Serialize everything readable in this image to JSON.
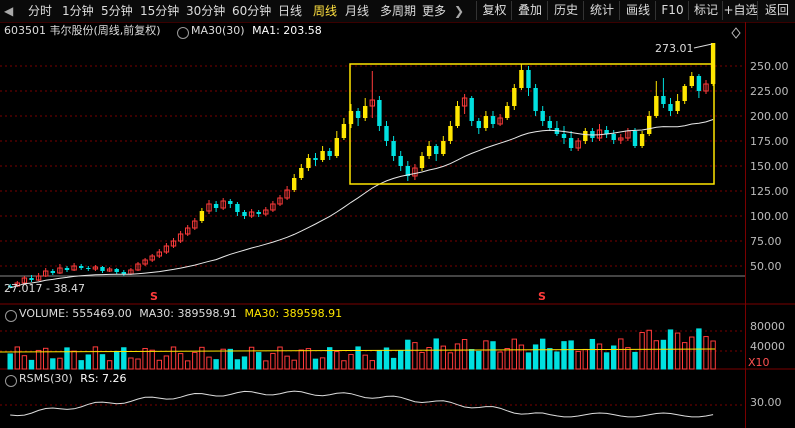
{
  "toolbar": {
    "left_arrow": "◀",
    "periods": [
      "分时",
      "1分钟",
      "5分钟",
      "15分钟",
      "30分钟",
      "60分钟",
      "日线",
      "周线",
      "月线",
      "多周期",
      "更多"
    ],
    "active_period": "周线",
    "more_arrow": "❯",
    "buttons": [
      "复权",
      "叠加",
      "历史",
      "统计",
      "画线",
      "F10",
      "标记",
      "+自选",
      "返回"
    ]
  },
  "info": {
    "code_name": "603501 韦尔股份(周线,前复权)",
    "ma_setting": "MA30(30)",
    "ma1": "MA1: 203.58"
  },
  "price_chart": {
    "high_label": "273.01",
    "low_label": "27.017 - 38.47",
    "y_ticks": [
      "250.00",
      "225.00",
      "200.00",
      "175.00",
      "150.00",
      "125.00",
      "100.00",
      "75.00",
      "50.00"
    ],
    "split_marker": "S",
    "colors": {
      "up": "#ff3b3b",
      "down": "#00e0e0",
      "yellow": "#ffe600",
      "ma": "#e8e8e8",
      "grid": "#7a0000"
    }
  },
  "volume": {
    "label": "VOLUME: 555469.00",
    "ma_a": "MA30: 389598.91",
    "ma_b": "MA30: 389598.91",
    "y_ticks": [
      "80000",
      "40000"
    ],
    "unit": "X10"
  },
  "rsms": {
    "label": "RSMS(30)",
    "value": "RS: 7.26",
    "y_ticks": [
      "30.00"
    ]
  },
  "chart_data": {
    "type": "candlestick",
    "period": "weekly",
    "ylim": [
      27,
      275
    ],
    "candles": [
      [
        30,
        29,
        32,
        28
      ],
      [
        30,
        33,
        35,
        29
      ],
      [
        33,
        38,
        40,
        32
      ],
      [
        38,
        36,
        41,
        34
      ],
      [
        36,
        40,
        43,
        35
      ],
      [
        40,
        45,
        48,
        39
      ],
      [
        45,
        43,
        47,
        41
      ],
      [
        43,
        48,
        52,
        42
      ],
      [
        48,
        46,
        50,
        44
      ],
      [
        46,
        50,
        53,
        45
      ],
      [
        50,
        48,
        52,
        46
      ],
      [
        48,
        47,
        50,
        45
      ],
      [
        47,
        49,
        51,
        45
      ],
      [
        49,
        45,
        50,
        43
      ],
      [
        45,
        47,
        49,
        44
      ],
      [
        47,
        44,
        48,
        42
      ],
      [
        44,
        42,
        46,
        40
      ],
      [
        42,
        46,
        48,
        41
      ],
      [
        46,
        52,
        54,
        45
      ],
      [
        52,
        56,
        58,
        50
      ],
      [
        56,
        60,
        62,
        54
      ],
      [
        60,
        64,
        67,
        58
      ],
      [
        64,
        70,
        73,
        62
      ],
      [
        70,
        75,
        78,
        68
      ],
      [
        75,
        82,
        85,
        73
      ],
      [
        82,
        88,
        91,
        80
      ],
      [
        88,
        95,
        98,
        86
      ],
      [
        95,
        105,
        108,
        93
      ],
      [
        105,
        112,
        116,
        102
      ],
      [
        112,
        108,
        115,
        104
      ],
      [
        108,
        115,
        118,
        106
      ],
      [
        115,
        112,
        117,
        108
      ],
      [
        112,
        104,
        114,
        100
      ],
      [
        104,
        100,
        106,
        97
      ],
      [
        100,
        104,
        107,
        98
      ],
      [
        104,
        102,
        106,
        99
      ],
      [
        102,
        106,
        109,
        100
      ],
      [
        106,
        112,
        115,
        104
      ],
      [
        112,
        118,
        121,
        110
      ],
      [
        118,
        126,
        130,
        116
      ],
      [
        126,
        138,
        142,
        124
      ],
      [
        138,
        148,
        152,
        136
      ],
      [
        148,
        158,
        162,
        145
      ],
      [
        158,
        156,
        163,
        150
      ],
      [
        156,
        165,
        170,
        154
      ],
      [
        165,
        160,
        168,
        156
      ],
      [
        160,
        178,
        185,
        158
      ],
      [
        178,
        192,
        198,
        176
      ],
      [
        192,
        205,
        212,
        188
      ],
      [
        205,
        198,
        208,
        190
      ],
      [
        198,
        210,
        218,
        195
      ],
      [
        210,
        216,
        245,
        198
      ],
      [
        216,
        190,
        220,
        185
      ],
      [
        190,
        175,
        195,
        170
      ],
      [
        175,
        160,
        180,
        155
      ],
      [
        160,
        150,
        165,
        145
      ],
      [
        150,
        140,
        155,
        135
      ],
      [
        140,
        148,
        152,
        136
      ],
      [
        148,
        160,
        164,
        145
      ],
      [
        160,
        170,
        175,
        157
      ],
      [
        170,
        162,
        172,
        155
      ],
      [
        162,
        175,
        180,
        160
      ],
      [
        175,
        190,
        195,
        172
      ],
      [
        190,
        210,
        215,
        188
      ],
      [
        210,
        218,
        222,
        202
      ],
      [
        218,
        195,
        220,
        190
      ],
      [
        195,
        188,
        198,
        182
      ],
      [
        188,
        200,
        205,
        185
      ],
      [
        200,
        192,
        205,
        188
      ],
      [
        192,
        198,
        202,
        190
      ],
      [
        198,
        210,
        214,
        196
      ],
      [
        210,
        228,
        232,
        206
      ],
      [
        228,
        246,
        252,
        226
      ],
      [
        246,
        228,
        250,
        220
      ],
      [
        228,
        205,
        232,
        200
      ],
      [
        205,
        195,
        210,
        190
      ],
      [
        195,
        188,
        200,
        185
      ],
      [
        188,
        182,
        195,
        180
      ],
      [
        182,
        178,
        190,
        172
      ],
      [
        178,
        168,
        185,
        165
      ],
      [
        168,
        175,
        178,
        165
      ],
      [
        175,
        185,
        188,
        172
      ],
      [
        185,
        178,
        188,
        174
      ],
      [
        178,
        186,
        192,
        175
      ],
      [
        186,
        182,
        190,
        178
      ],
      [
        182,
        176,
        186,
        172
      ],
      [
        176,
        178,
        182,
        172
      ],
      [
        178,
        185,
        188,
        175
      ],
      [
        185,
        170,
        188,
        168
      ],
      [
        170,
        182,
        185,
        168
      ],
      [
        182,
        200,
        205,
        180
      ],
      [
        200,
        220,
        235,
        198
      ],
      [
        220,
        212,
        238,
        208
      ],
      [
        212,
        205,
        218,
        200
      ],
      [
        205,
        215,
        222,
        202
      ],
      [
        215,
        230,
        232,
        212
      ],
      [
        230,
        240,
        244,
        228
      ],
      [
        240,
        225,
        242,
        218
      ],
      [
        225,
        232,
        236,
        222
      ],
      [
        232,
        273,
        273,
        230
      ]
    ],
    "ma30_last": 203.58,
    "volume_last": 555469.0,
    "volume_ma30": 389598.91,
    "rs_last": 7.26
  }
}
